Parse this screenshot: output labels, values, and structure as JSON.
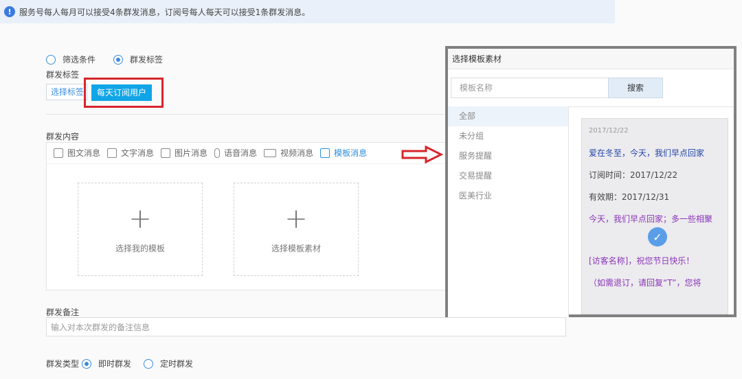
{
  "notice": {
    "text": "服务号每人每月可以接受4条群发消息，订阅号每人每天可以接受1条群发消息。"
  },
  "filter": {
    "option1": "筛选条件",
    "option2": "群发标签",
    "selected": "群发标签"
  },
  "tag_section": {
    "label": "群发标签",
    "select_button": "选择标签",
    "tag": "每天订阅用户"
  },
  "content": {
    "label": "群发内容",
    "tabs": [
      "图文消息",
      "文字消息",
      "图片消息",
      "语音消息",
      "视频消息",
      "模板消息"
    ],
    "active_tab": "模板消息",
    "cards": [
      "选择我的模板",
      "选择模板素材"
    ]
  },
  "remark": {
    "label": "群发备注",
    "placeholder": "输入对本次群发的备注信息"
  },
  "send_type": {
    "label": "群发类型",
    "option1": "即时群发",
    "option2": "定时群发",
    "selected": "即时群发"
  },
  "modal": {
    "title": "选择模板素材",
    "search_placeholder": "模板名称",
    "search_button": "搜索",
    "categories": [
      "全部",
      "未分组",
      "服务提醒",
      "交易提醒",
      "医美行业"
    ],
    "active_category": "全部",
    "template": {
      "date": "2017/12/22",
      "lines": [
        "爱在冬至，今天，我们早点回家",
        "订阅时间：2017/12/22",
        "有效期：2017/12/31",
        "今天，我们早点回家；多一些相聚",
        "",
        "[访客名称]，祝您节日快乐！",
        "（如需退订，请回复“T”，您将"
      ]
    }
  },
  "colors": {
    "accent": "#11a5e8",
    "highlight_red": "#d6252b",
    "modal_border": "#808080"
  }
}
